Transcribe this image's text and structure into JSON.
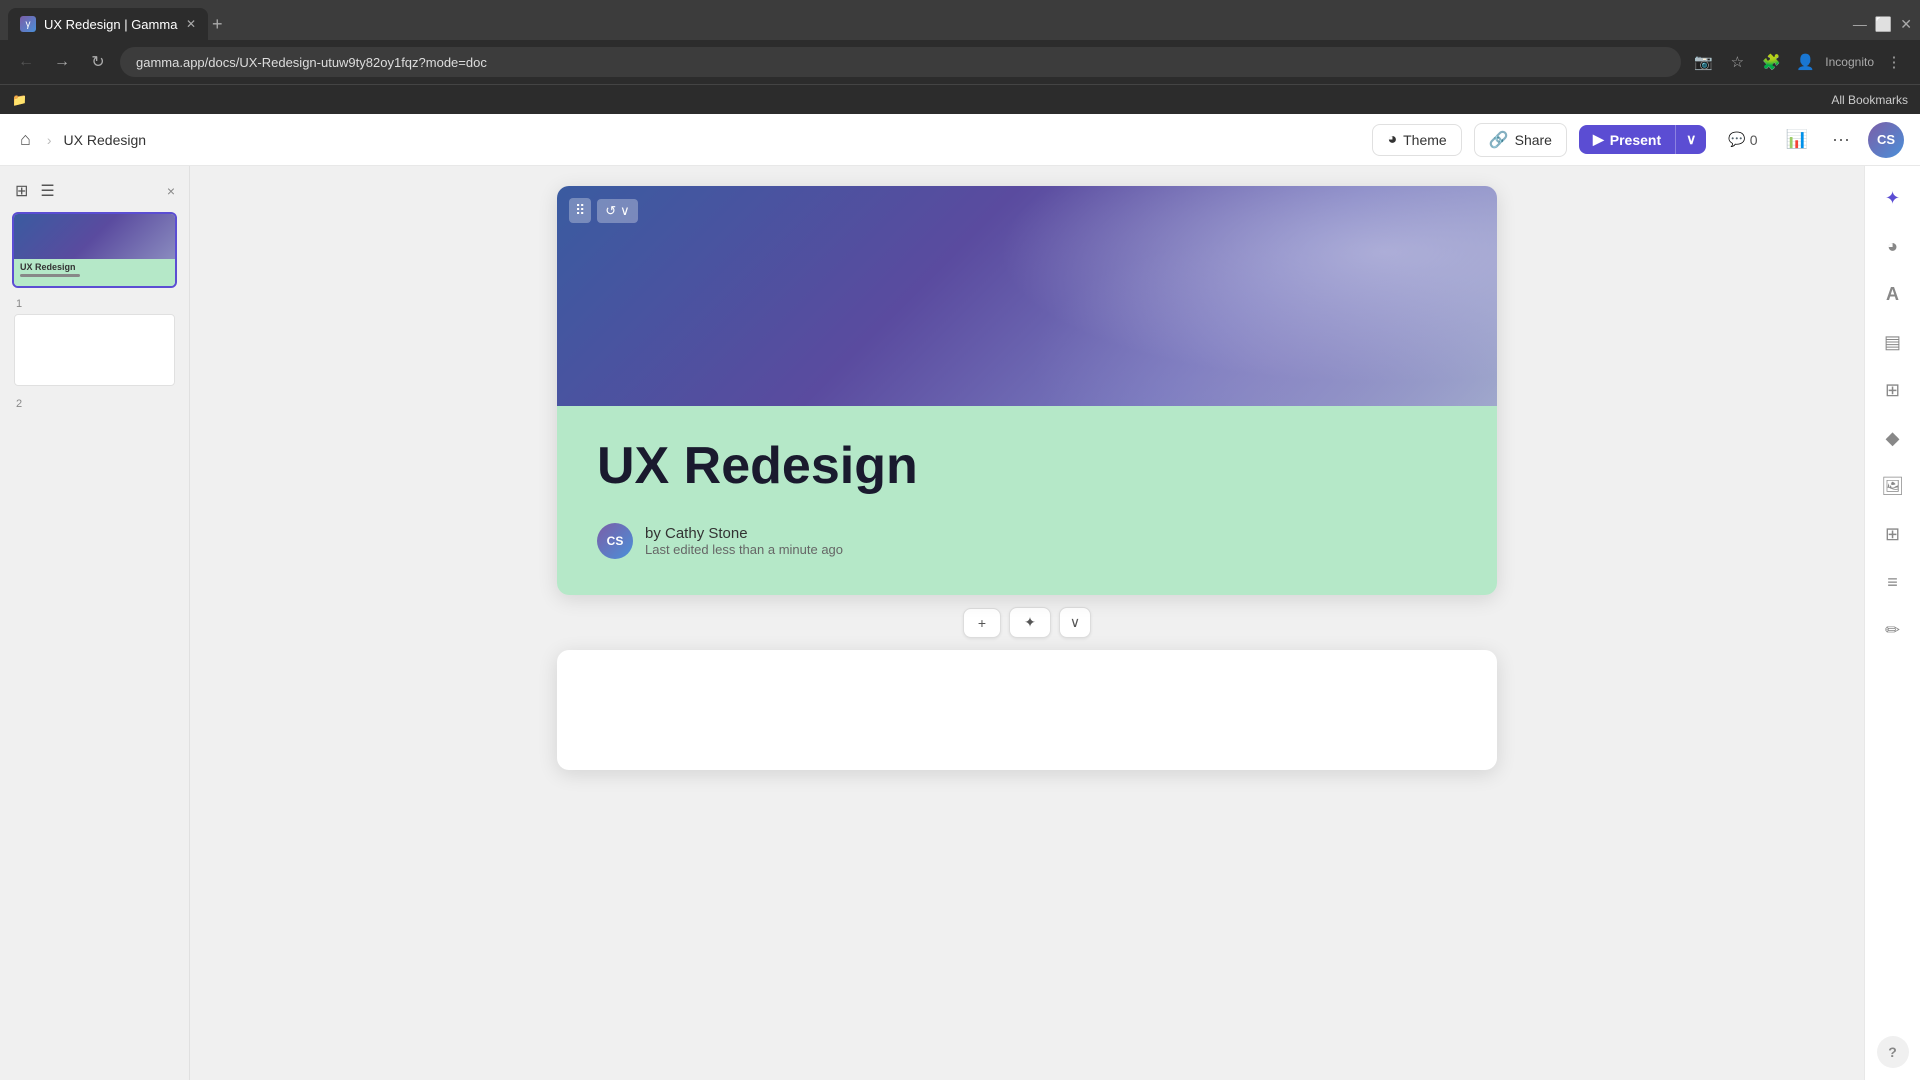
{
  "browser": {
    "tab_title": "UX Redesign | Gamma",
    "tab_favicon": "γ",
    "address": "gamma.app/docs/UX-Redesign-utuw9ty82oy1fqz?mode=doc",
    "bookmarks_label": "All Bookmarks",
    "incognito_label": "Incognito"
  },
  "topbar": {
    "home_icon": "⌂",
    "breadcrumb_separator": "›",
    "breadcrumb": "UX Redesign",
    "theme_label": "Theme",
    "share_label": "Share",
    "present_label": "Present",
    "comments_count": "0",
    "avatar_initials": "CS"
  },
  "slide_panel": {
    "close_icon": "×",
    "slide_1_label": "UX Redesign",
    "slide_1_number": "1",
    "slide_2_number": "2"
  },
  "slide_1": {
    "title": "UX Redesign",
    "author_name": "by Cathy Stone",
    "author_initials": "CS",
    "last_edited": "Last edited less than a minute ago"
  },
  "between_slides": {
    "add_label": "+",
    "ai_label": "✦",
    "dropdown_label": "∨"
  },
  "right_sidebar": {
    "ai_icon": "✦",
    "theme_icon": "◕",
    "text_icon": "A",
    "cards_icon": "▤",
    "layout_icon": "⊞",
    "shapes_icon": "◆",
    "image_icon": "⊡",
    "table_icon": "⊞",
    "media_icon": "≡",
    "edit_icon": "✏",
    "help_label": "?"
  },
  "colors": {
    "accent": "#5b4dd3",
    "slide_bg_bottom": "#b5e8c8",
    "slide_bg_top_start": "#3a5ba0",
    "slide_bg_top_end": "#7a7bbf"
  }
}
